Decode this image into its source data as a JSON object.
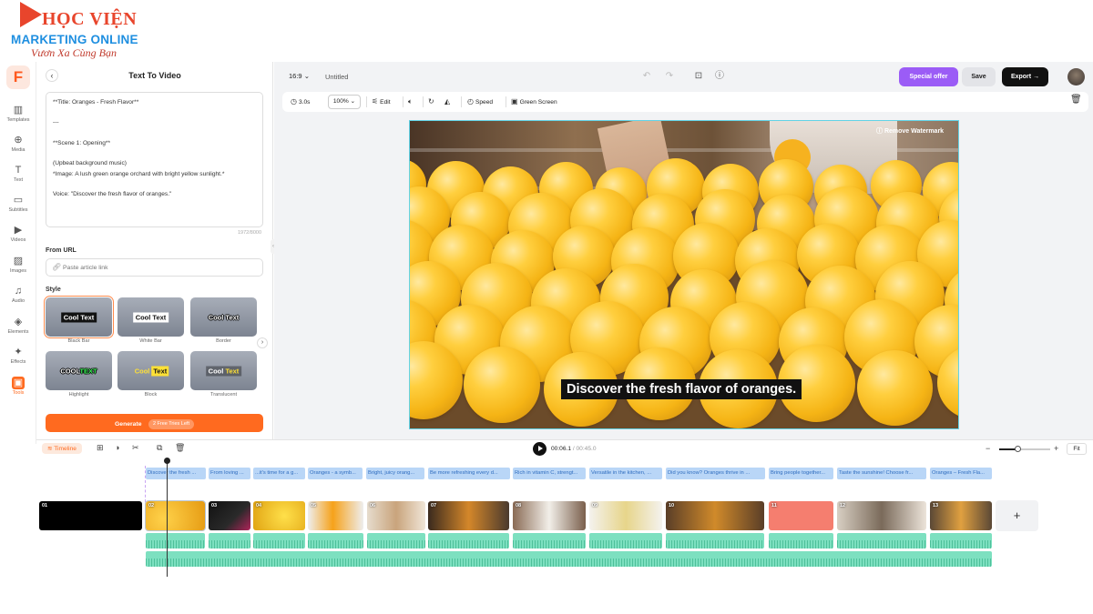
{
  "watermark": {
    "line1": "HỌC VIỆN",
    "line2": "MARKETING ONLINE",
    "line3": "Vươn Xa Cùng Bạn"
  },
  "rail": {
    "logo": "F",
    "items": [
      {
        "label": "Templates",
        "icon": "templates-icon",
        "glyph": "▥"
      },
      {
        "label": "Media",
        "icon": "media-icon",
        "glyph": "⊕"
      },
      {
        "label": "Text",
        "icon": "text-icon",
        "glyph": "T"
      },
      {
        "label": "Subtitles",
        "icon": "subtitles-icon",
        "glyph": "▭"
      },
      {
        "label": "Videos",
        "icon": "videos-icon",
        "glyph": "▶"
      },
      {
        "label": "Images",
        "icon": "images-icon",
        "glyph": "▨"
      },
      {
        "label": "Audio",
        "icon": "audio-icon",
        "glyph": "♫"
      },
      {
        "label": "Elements",
        "icon": "elements-icon",
        "glyph": "◈"
      },
      {
        "label": "Effects",
        "icon": "effects-icon",
        "glyph": "✦"
      },
      {
        "label": "Tools",
        "icon": "tools-icon",
        "glyph": "▣"
      }
    ]
  },
  "panel": {
    "title": "Text To Video",
    "back": "‹",
    "script_lines": [
      "**Title: Oranges - Fresh Flavor**",
      "",
      "---",
      "",
      "**Scene 1: Opening**",
      "",
      "(Upbeat background music)",
      "*Image: A lush green orange orchard with bright yellow sunlight.*",
      "",
      "Voice: \"Discover the fresh flavor of oranges.\""
    ],
    "char_count": "1972/8000",
    "url_label": "From URL",
    "url_placeholder": "Paste article link",
    "style_label": "Style",
    "styles": [
      {
        "name": "Black Bar",
        "sample": "Cool Text"
      },
      {
        "name": "White Bar",
        "sample": "Cool Text"
      },
      {
        "name": "Border",
        "sample": "Cool Text"
      },
      {
        "name": "Highlight",
        "sample_a": "COOL",
        "sample_b": "TEXT"
      },
      {
        "name": "Block",
        "sample_a": "Cool",
        "sample_b": "Text"
      },
      {
        "name": "Translucent",
        "sample_a": "Cool",
        "sample_b": "Text"
      }
    ],
    "generate_label": "Generate",
    "generate_badge": "2 Free Tries Left"
  },
  "topbar": {
    "ratio": "16:9",
    "title": "Untitled",
    "special_offer": "Special offer",
    "save": "Save",
    "export": "Export"
  },
  "toolbar": {
    "duration": "3.0s",
    "zoom": "100%",
    "edit": "Edit",
    "speed": "Speed",
    "green_screen": "Green Screen"
  },
  "preview": {
    "subtitle": "Discover the fresh flavor of oranges.",
    "remove_watermark": "Remove Watermark"
  },
  "timeline": {
    "tab": "Timeline",
    "current_time": "00:06.1",
    "total_time": "/ 00:45.0",
    "fit": "Fit",
    "captions": [
      "Discover the fresh ...",
      "From loving ...",
      "...it's time for a g...",
      "Oranges - a symb...",
      "Bright, juicy orang...",
      "Be more refreshing every d...",
      "Rich in vitamin C, strengt...",
      "Versatile in the kitchen, ...",
      "Did you know? Oranges thrive in ...",
      "Bring people together...",
      "Taste the sunshine! Choose fr...",
      "Oranges – Fresh Fla..."
    ],
    "clips": [
      "01",
      "02",
      "03",
      "04",
      "05",
      "06",
      "07",
      "08",
      "09",
      "10",
      "11",
      "12",
      "13"
    ]
  }
}
